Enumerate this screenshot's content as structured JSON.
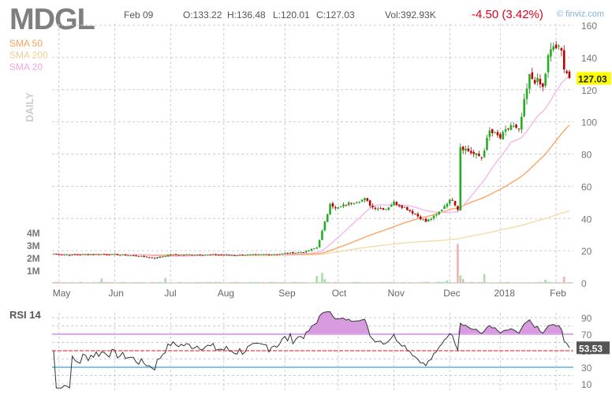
{
  "header": {
    "ticker": "MDGL",
    "date": "Feb 09",
    "open": "O:133.22",
    "high": "H:136.48",
    "low": "L:120.01",
    "close": "C:127.03",
    "volume": "Vol:392.93K",
    "change": "-4.50 (3.42%)",
    "brand": "© finviz.com"
  },
  "legend": {
    "sma50": "SMA 50",
    "sma200": "SMA 200",
    "sma20": "SMA 20",
    "period": "DAILY",
    "rsi": "RSI 14"
  },
  "colors": {
    "up": "#22b022",
    "down": "#c00000",
    "sma50": "#ff9f5a",
    "sma200": "#f5d9a0",
    "sma20": "#f5b3e8",
    "rsi_fill": "#d89be0",
    "rsi70": "#e0a8f0",
    "rsi50": "#f08a8a",
    "rsi30": "#7ec8ec",
    "last_price_bg": "#ffff00"
  },
  "chart_data": {
    "type": "candlestick",
    "price_axis": {
      "ticks": [
        "160",
        "140",
        "120",
        "100",
        "80",
        "60",
        "40",
        "20",
        "0"
      ],
      "ylim": [
        0,
        160
      ]
    },
    "volume_axis": {
      "ticks": [
        "4M",
        "3M",
        "2M",
        "1M"
      ],
      "ylim_millions": [
        0,
        10
      ]
    },
    "rsi_axis": {
      "ticks": [
        "90",
        "70",
        "50",
        "30",
        "10"
      ],
      "ylim": [
        0,
        100
      ]
    },
    "x_labels": [
      {
        "label": "May",
        "day": 2
      },
      {
        "label": "Jun",
        "day": 23
      },
      {
        "label": "Jul",
        "day": 44
      },
      {
        "label": "Aug",
        "day": 64
      },
      {
        "label": "Sep",
        "day": 87
      },
      {
        "label": "Oct",
        "day": 107
      },
      {
        "label": "Nov",
        "day": 128
      },
      {
        "label": "Dec",
        "day": 149
      },
      {
        "label": "2018",
        "day": 168
      },
      {
        "label": "Feb",
        "day": 189
      }
    ],
    "days": 195,
    "close_anchors": [
      [
        0,
        18
      ],
      [
        5,
        17.5
      ],
      [
        20,
        17.8
      ],
      [
        30,
        17
      ],
      [
        38,
        15.5
      ],
      [
        44,
        17.5
      ],
      [
        55,
        17.6
      ],
      [
        70,
        17.3
      ],
      [
        85,
        18
      ],
      [
        95,
        19.5
      ],
      [
        99,
        22
      ],
      [
        101,
        32
      ],
      [
        103,
        43
      ],
      [
        104,
        50
      ],
      [
        106,
        46
      ],
      [
        112,
        50
      ],
      [
        117,
        52
      ],
      [
        120,
        47
      ],
      [
        125,
        46
      ],
      [
        128,
        50
      ],
      [
        133,
        46
      ],
      [
        140,
        38
      ],
      [
        144,
        42
      ],
      [
        148,
        50
      ],
      [
        150,
        52
      ],
      [
        152,
        46
      ],
      [
        153,
        85
      ],
      [
        158,
        80
      ],
      [
        161,
        78
      ],
      [
        164,
        94
      ],
      [
        168,
        90
      ],
      [
        172,
        98
      ],
      [
        175,
        94
      ],
      [
        177,
        112
      ],
      [
        179,
        128
      ],
      [
        182,
        125
      ],
      [
        184,
        121
      ],
      [
        186,
        140
      ],
      [
        188,
        147
      ],
      [
        190,
        145
      ],
      [
        191,
        143
      ],
      [
        192,
        135
      ],
      [
        193,
        131
      ],
      [
        194,
        127.03
      ]
    ],
    "volume_spikes_millions": [
      [
        18,
        0.35
      ],
      [
        42,
        0.4
      ],
      [
        99,
        0.55
      ],
      [
        101,
        0.8
      ],
      [
        102,
        0.3
      ],
      [
        148,
        0.2
      ],
      [
        152,
        3.1
      ],
      [
        153,
        0.6
      ],
      [
        154,
        0.3
      ],
      [
        162,
        0.7
      ],
      [
        185,
        0.25
      ],
      [
        192,
        0.5
      ]
    ],
    "last_price": "127.03",
    "last_rsi": "53.53"
  }
}
